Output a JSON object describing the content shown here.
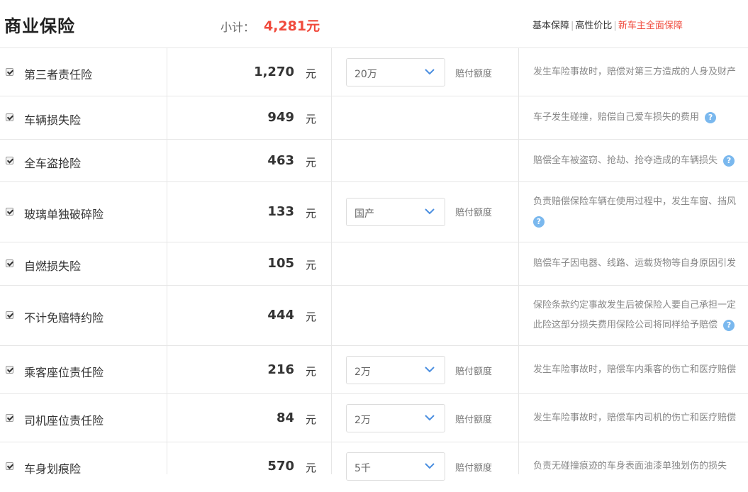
{
  "header": {
    "title": "商业保险",
    "subtotal_label": "小计：",
    "subtotal_value": "4,281元",
    "plans": [
      "基本保障",
      "高性价比",
      "新车主全面保障"
    ]
  },
  "colors": {
    "accent": "#f04a3c",
    "help": "#7ab8ee",
    "border": "#e6e6e6"
  },
  "rows": [
    {
      "name": "第三者责任险",
      "price": "1,270",
      "unit": "元",
      "option": "20万",
      "amount_label": "赔付额度",
      "desc1": "发生车险事故时，赔偿对第三方造成的人身及财产",
      "desc2": ""
    },
    {
      "name": "车辆损失险",
      "price": "949",
      "unit": "元",
      "option": "",
      "amount_label": "",
      "desc1": "车子发生碰撞，赔偿自己爱车损失的费用",
      "desc2": ""
    },
    {
      "name": "全车盗抢险",
      "price": "463",
      "unit": "元",
      "option": "",
      "amount_label": "",
      "desc1": "赔偿全车被盗窃、抢劫、抢夺造成的车辆损失",
      "desc2": ""
    },
    {
      "name": "玻璃单独破碎险",
      "price": "133",
      "unit": "元",
      "option": "国产",
      "amount_label": "赔付额度",
      "desc1": "负责赔偿保险车辆在使用过程中，发生车窗、挡风",
      "desc2": ""
    },
    {
      "name": "自燃损失险",
      "price": "105",
      "unit": "元",
      "option": "",
      "amount_label": "",
      "desc1": "赔偿车子因电器、线路、运载货物等自身原因引发",
      "desc2": ""
    },
    {
      "name": "不计免赔特约险",
      "price": "444",
      "unit": "元",
      "option": "",
      "amount_label": "",
      "desc1": "保险条款约定事故发生后被保险人要自己承担一定",
      "desc2": "此险这部分损失费用保险公司将同样给予赔偿"
    },
    {
      "name": "乘客座位责任险",
      "price": "216",
      "unit": "元",
      "option": "2万",
      "amount_label": "赔付额度",
      "desc1": "发生车险事故时，赔偿车内乘客的伤亡和医疗赔偿",
      "desc2": ""
    },
    {
      "name": "司机座位责任险",
      "price": "84",
      "unit": "元",
      "option": "2万",
      "amount_label": "赔付额度",
      "desc1": "发生车险事故时，赔偿车内司机的伤亡和医疗赔偿",
      "desc2": ""
    },
    {
      "name": "车身划痕险",
      "price": "570",
      "unit": "元",
      "option": "5千",
      "amount_label": "赔付额度",
      "desc1": "负责无碰撞痕迹的车身表面油漆单独划伤的损失",
      "desc2": ""
    }
  ]
}
